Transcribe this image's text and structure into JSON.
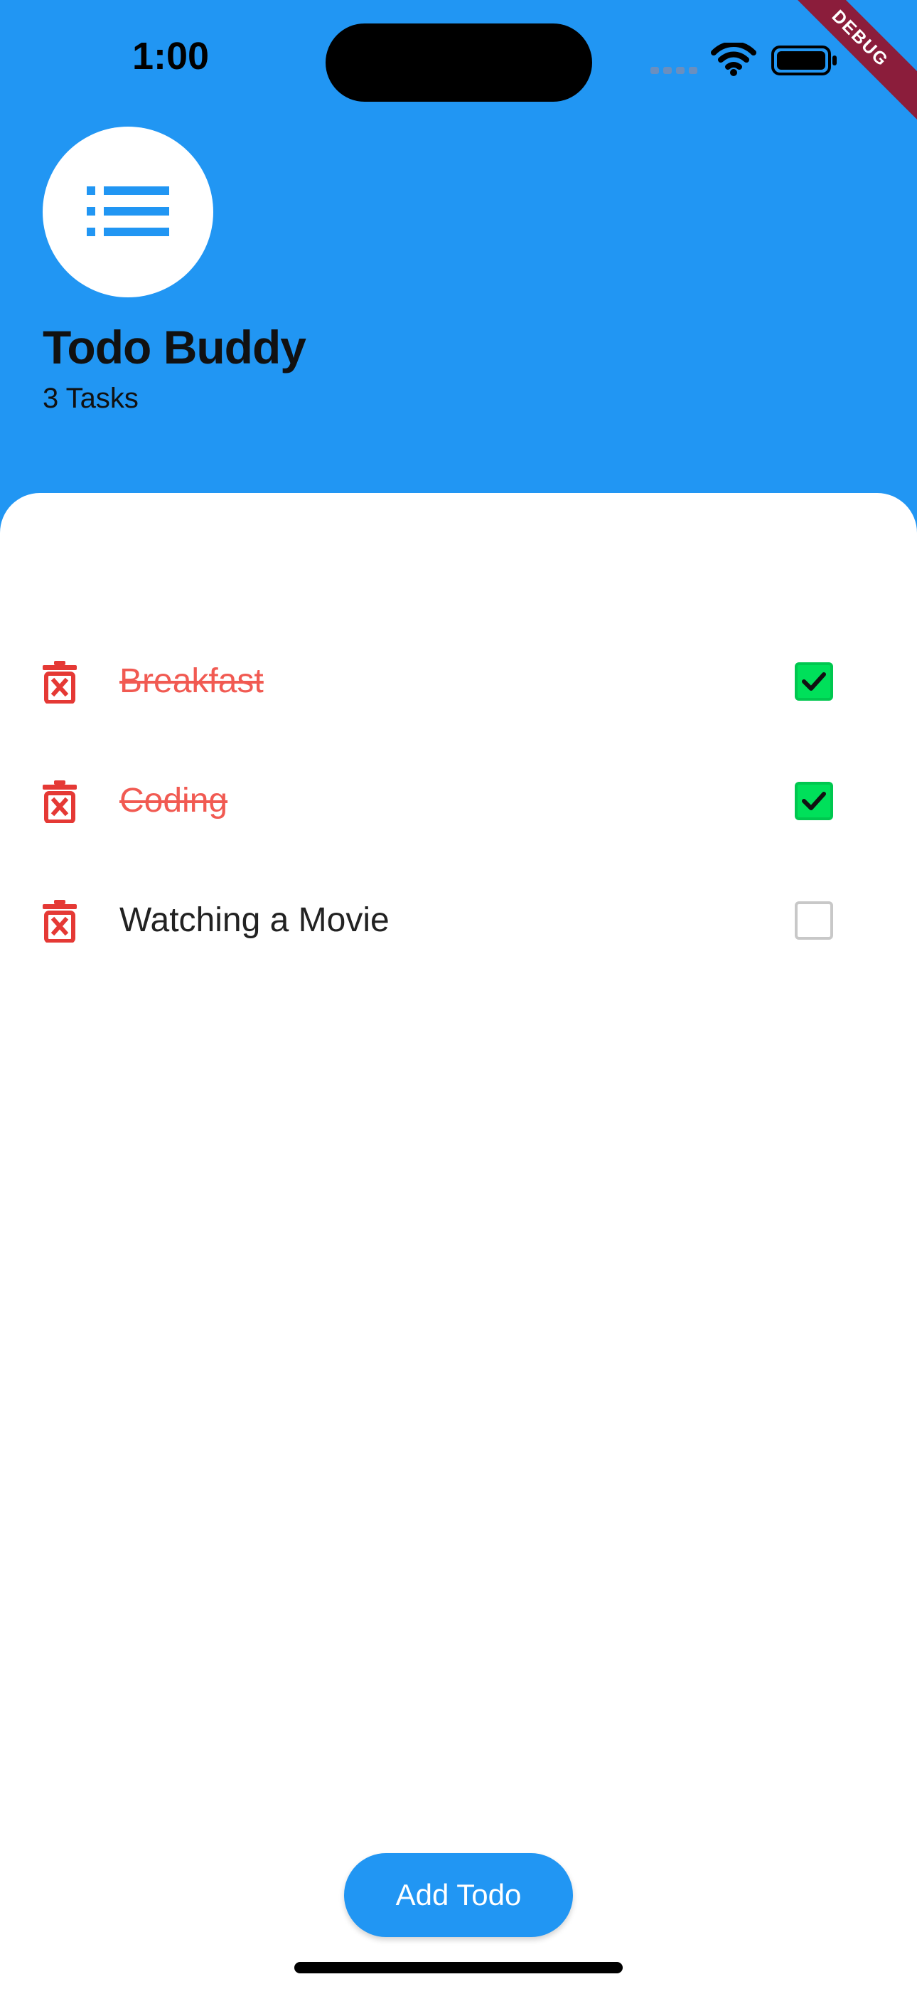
{
  "status_bar": {
    "time": "1:00",
    "signal_icon": "cellular-dots-icon",
    "wifi_icon": "wifi-icon",
    "battery_icon": "battery-icon"
  },
  "debug_banner": "DEBUG",
  "header": {
    "logo_icon": "list-icon",
    "title": "Todo Buddy",
    "task_count": "3 Tasks"
  },
  "todos": [
    {
      "label": "Breakfast",
      "done": true
    },
    {
      "label": "Coding",
      "done": true
    },
    {
      "label": "Watching a Movie",
      "done": false
    }
  ],
  "add_button_label": "Add Todo",
  "colors": {
    "primary": "#2196F3",
    "delete_red": "#E53935",
    "done_text": "#F15A52",
    "checkbox_green": "#00E05A",
    "surface": "#FFFFFF"
  }
}
